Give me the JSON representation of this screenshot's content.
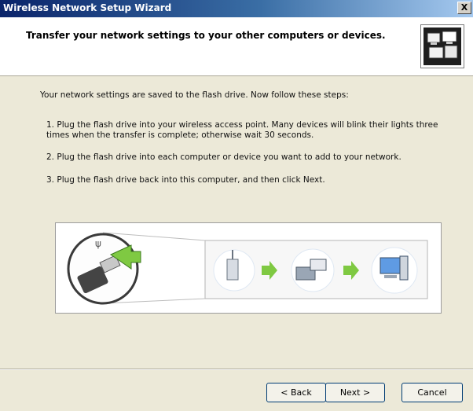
{
  "window": {
    "title": "Wireless Network Setup Wizard",
    "close_label": "X"
  },
  "header": {
    "title": "Transfer your network settings to your other computers or devices."
  },
  "content": {
    "intro": "Your network settings are saved to the flash drive. Now follow these steps:",
    "step1": "1. Plug the flash drive into your wireless access point. Many devices will blink their lights three times when the transfer is complete; otherwise wait 30 seconds.",
    "step2": "2. Plug the flash drive into each computer or device you want to add to your network.",
    "step3": "3. Plug the flash drive back into this computer, and then click Next."
  },
  "buttons": {
    "back": "< Back",
    "next": "Next >",
    "cancel": "Cancel"
  },
  "colors": {
    "titlebar": "#0a246a",
    "dialog_bg": "#ece9d8",
    "arrow_green": "#7fc942"
  }
}
